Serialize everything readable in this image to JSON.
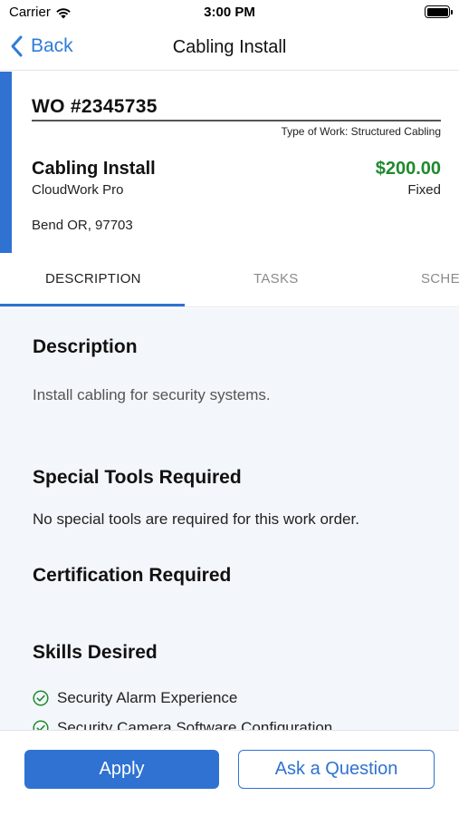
{
  "status_bar": {
    "carrier": "Carrier",
    "time": "3:00 PM"
  },
  "nav": {
    "back_label": "Back",
    "title": "Cabling Install"
  },
  "work_order": {
    "number": "WO #2345735",
    "type_of_work": "Type of Work: Structured Cabling",
    "title": "Cabling Install",
    "company": "CloudWork Pro",
    "price": "$200.00",
    "price_type": "Fixed",
    "location": "Bend OR, 97703",
    "accent_color": "#2f72d2",
    "price_color": "#1f8a2e"
  },
  "tabs": [
    {
      "label": "DESCRIPTION",
      "active": true
    },
    {
      "label": "TASKS",
      "active": false
    },
    {
      "label": "SCHEDULE",
      "active": false
    }
  ],
  "content": {
    "description_heading": "Description",
    "description_text": "Install cabling for security systems.",
    "tools_heading": "Special Tools Required",
    "tools_text": "No special tools are required for this work order.",
    "certification_heading": "Certification Required",
    "skills_heading": "Skills Desired",
    "skills": [
      {
        "label": "Security Alarm Experience",
        "icon": "check-circle-icon"
      },
      {
        "label": "Security Camera Software Configuration",
        "icon": "check-circle-icon"
      }
    ]
  },
  "actions": {
    "apply_label": "Apply",
    "ask_label": "Ask a Question"
  }
}
